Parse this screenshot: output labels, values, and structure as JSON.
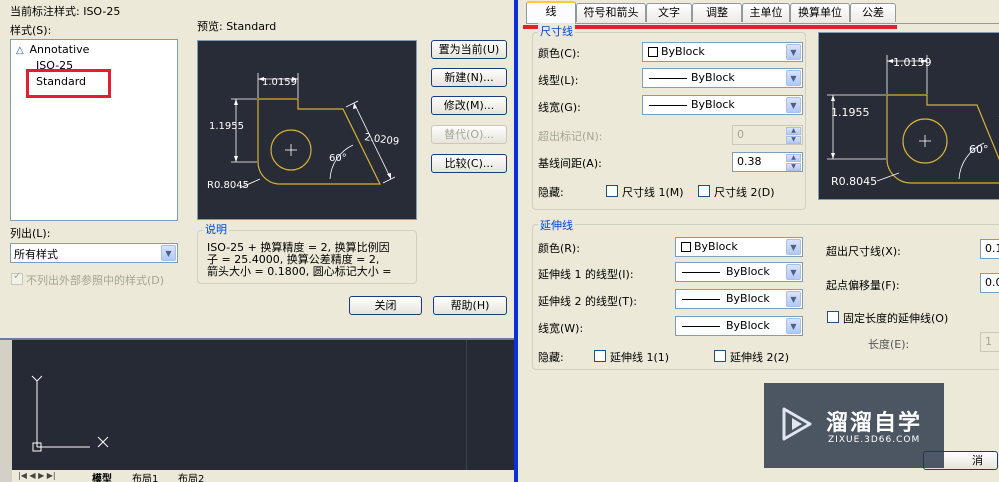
{
  "left_dialog": {
    "current_style_label": "当前标注样式: ISO-25",
    "styles_label": "样式(S):",
    "styles": [
      "Annotative",
      "ISO-25",
      "Standard"
    ],
    "preview_label": "预览: Standard",
    "list_label": "列出(L):",
    "list_value": "所有样式",
    "exclude_xref_label": "不列出外部参照中的样式(D)",
    "buttons": {
      "set_current": "置为当前(U)",
      "new": "新建(N)...",
      "modify": "修改(M)...",
      "override": "替代(O)...",
      "compare": "比较(C)...",
      "close": "关闭",
      "help": "帮助(H)"
    },
    "description_title": "说明",
    "description_lines": [
      "ISO-25 + 换算精度 = 2, 换算比例因",
      "子 = 25.4000, 换算公差精度 = 2,",
      "箭头大小 = 0.1800, 圆心标记大小 ="
    ],
    "preview_dims": {
      "top": "1.0159",
      "left": "1.1955",
      "diag": "2.0209",
      "angle": "60°",
      "radius": "R0.8045"
    }
  },
  "model_space": {
    "axis_y": "Y",
    "axis_x": "X",
    "layout_tabs": [
      "模型",
      "布局1",
      "布局2"
    ]
  },
  "right_dialog": {
    "tabs": [
      "线",
      "符号和箭头",
      "文字",
      "调整",
      "主单位",
      "换算单位",
      "公差"
    ],
    "dim_lines": {
      "title": "尺寸线",
      "color_label": "颜色(C):",
      "color_value": "ByBlock",
      "linetype_label": "线型(L):",
      "linetype_value": "ByBlock",
      "lineweight_label": "线宽(G):",
      "lineweight_value": "ByBlock",
      "extend_ticks_label": "超出标记(N):",
      "extend_ticks_value": "0",
      "baseline_spacing_label": "基线间距(A):",
      "baseline_spacing_value": "0.38",
      "suppress_label": "隐藏:",
      "suppress_1": "尺寸线 1(M)",
      "suppress_2": "尺寸线 2(D)"
    },
    "ext_lines": {
      "title": "延伸线",
      "color_label": "颜色(R):",
      "color_value": "ByBlock",
      "linetype1_label": "延伸线 1 的线型(I):",
      "linetype1_value": "ByBlock",
      "linetype2_label": "延伸线 2 的线型(T):",
      "linetype2_value": "ByBlock",
      "lineweight_label": "线宽(W):",
      "lineweight_value": "ByBlock",
      "suppress_label": "隐藏:",
      "suppress_1": "延伸线 1(1)",
      "suppress_2": "延伸线 2(2)",
      "extend_beyond_label": "超出尺寸线(X):",
      "extend_beyond_value": "0.1",
      "offset_label": "起点偏移量(F):",
      "offset_value": "0.0",
      "fixed_length_label": "固定长度的延伸线(O)",
      "length_label": "长度(E):",
      "length_value": "1"
    },
    "preview_dims": {
      "top": "1.0159",
      "left": "1.1955",
      "angle": "60°",
      "radius": "R0.8045"
    },
    "cancel_partial": "消"
  },
  "watermark": {
    "brand": "溜溜自学",
    "url": "ZIXUE.3D66.COM"
  },
  "colors": {
    "highlight_red": "#e0202f",
    "group_title_blue": "#0046d5",
    "dim_yellow": "#d9b037",
    "xp_face": "#ece9d8"
  }
}
